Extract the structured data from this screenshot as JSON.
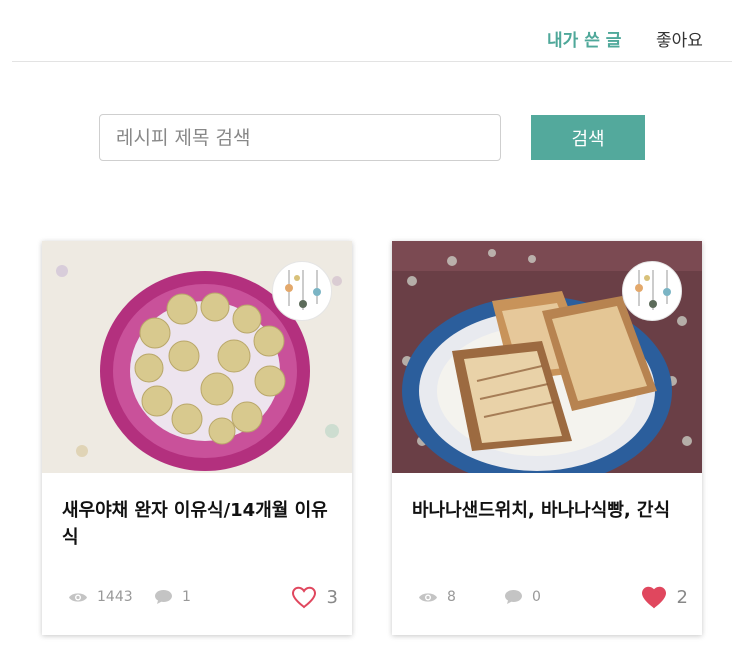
{
  "tabs": [
    {
      "label": "내가 쓴 글",
      "active": true
    },
    {
      "label": "좋아요",
      "active": false
    }
  ],
  "search": {
    "placeholder": "레시피 제목 검색",
    "value": "",
    "button_label": "검색"
  },
  "colors": {
    "accent": "#53a99c",
    "heart": "#e0475e"
  },
  "recipes": [
    {
      "title": "새우야채 완자 이유식/14개월 이유식",
      "views": "1443",
      "comments": "1",
      "likes": "3",
      "liked": false,
      "image": "photo of shrimp vegetable meatballs on a pink patterned plate"
    },
    {
      "title": "바나나샌드위치, 바나나식빵, 간식",
      "views": "8",
      "comments": "0",
      "likes": "2",
      "liked": true,
      "image": "photo of grilled banana sandwiches on a blue and white plate"
    }
  ]
}
